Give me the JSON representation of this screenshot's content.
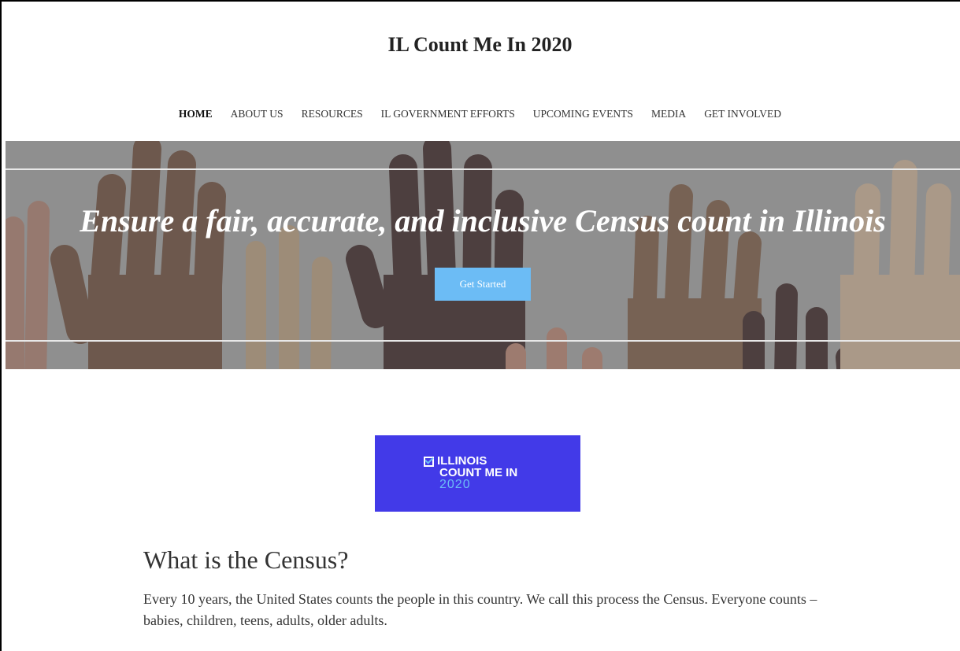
{
  "site": {
    "title": "IL Count Me In 2020"
  },
  "nav": {
    "items": [
      {
        "label": "HOME",
        "active": true
      },
      {
        "label": "ABOUT US",
        "active": false
      },
      {
        "label": "RESOURCES",
        "active": false
      },
      {
        "label": "IL GOVERNMENT EFFORTS",
        "active": false
      },
      {
        "label": "UPCOMING EVENTS",
        "active": false
      },
      {
        "label": "MEDIA",
        "active": false
      },
      {
        "label": "GET INVOLVED",
        "active": false
      }
    ]
  },
  "hero": {
    "headline": "Ensure a fair, accurate, and inclusive Census count in Illinois",
    "button_label": "Get Started"
  },
  "logo": {
    "line1": "ILLINOIS",
    "line2": "COUNT ME IN",
    "line3": "2020"
  },
  "section": {
    "title": "What is the Census?",
    "body": "Every 10 years, the United States counts the people in this country. We call this process the Census. Everyone counts – babies, children, teens, adults, older adults."
  },
  "colors": {
    "accent_button": "#6cbcf5",
    "logo_bg": "#423ae8"
  }
}
